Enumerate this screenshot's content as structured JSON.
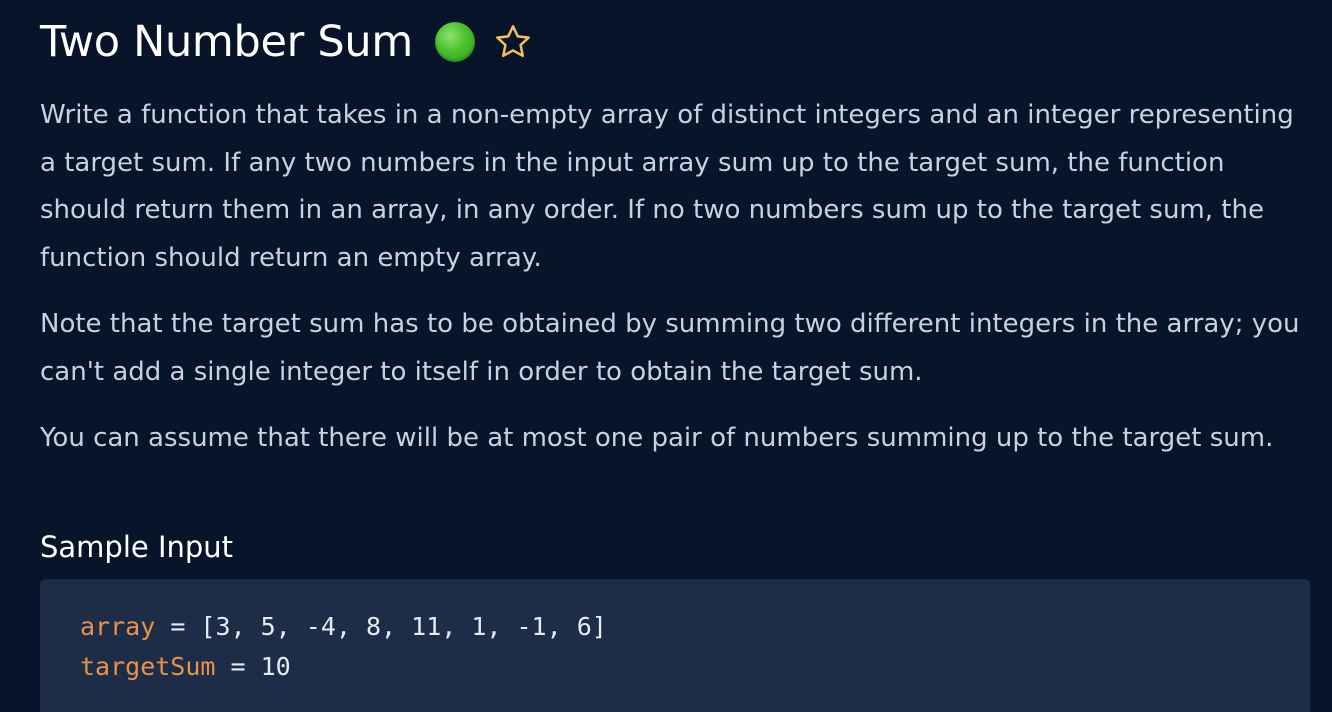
{
  "problem": {
    "title": "Two Number Sum",
    "difficulty_color": "#49c02d",
    "star_icon": "star-outline-icon",
    "paragraphs": [
      "Write a function that takes in a non-empty array of distinct integers and an integer representing a target sum. If any two numbers in the input array sum up to the target sum, the function should return them in an array, in any order. If no two numbers sum up to the target sum, the function should return an empty array.",
      "Note that the target sum has to be obtained by summing two different integers in the array; you can't add a single integer to itself in order to obtain the target sum.",
      "You can assume that there will be at most one pair of numbers summing up to the target sum."
    ]
  },
  "sample_input": {
    "heading": "Sample Input",
    "lines": [
      {
        "name": "array",
        "rest": " = [3, 5, -4, 8, 11, 1, -1, 6]"
      },
      {
        "name": "targetSum",
        "rest": " = 10"
      }
    ]
  },
  "colors": {
    "background": "#08142a",
    "code_background": "#1d2d47",
    "variable": "#e8914a",
    "star": "#f3c060"
  }
}
